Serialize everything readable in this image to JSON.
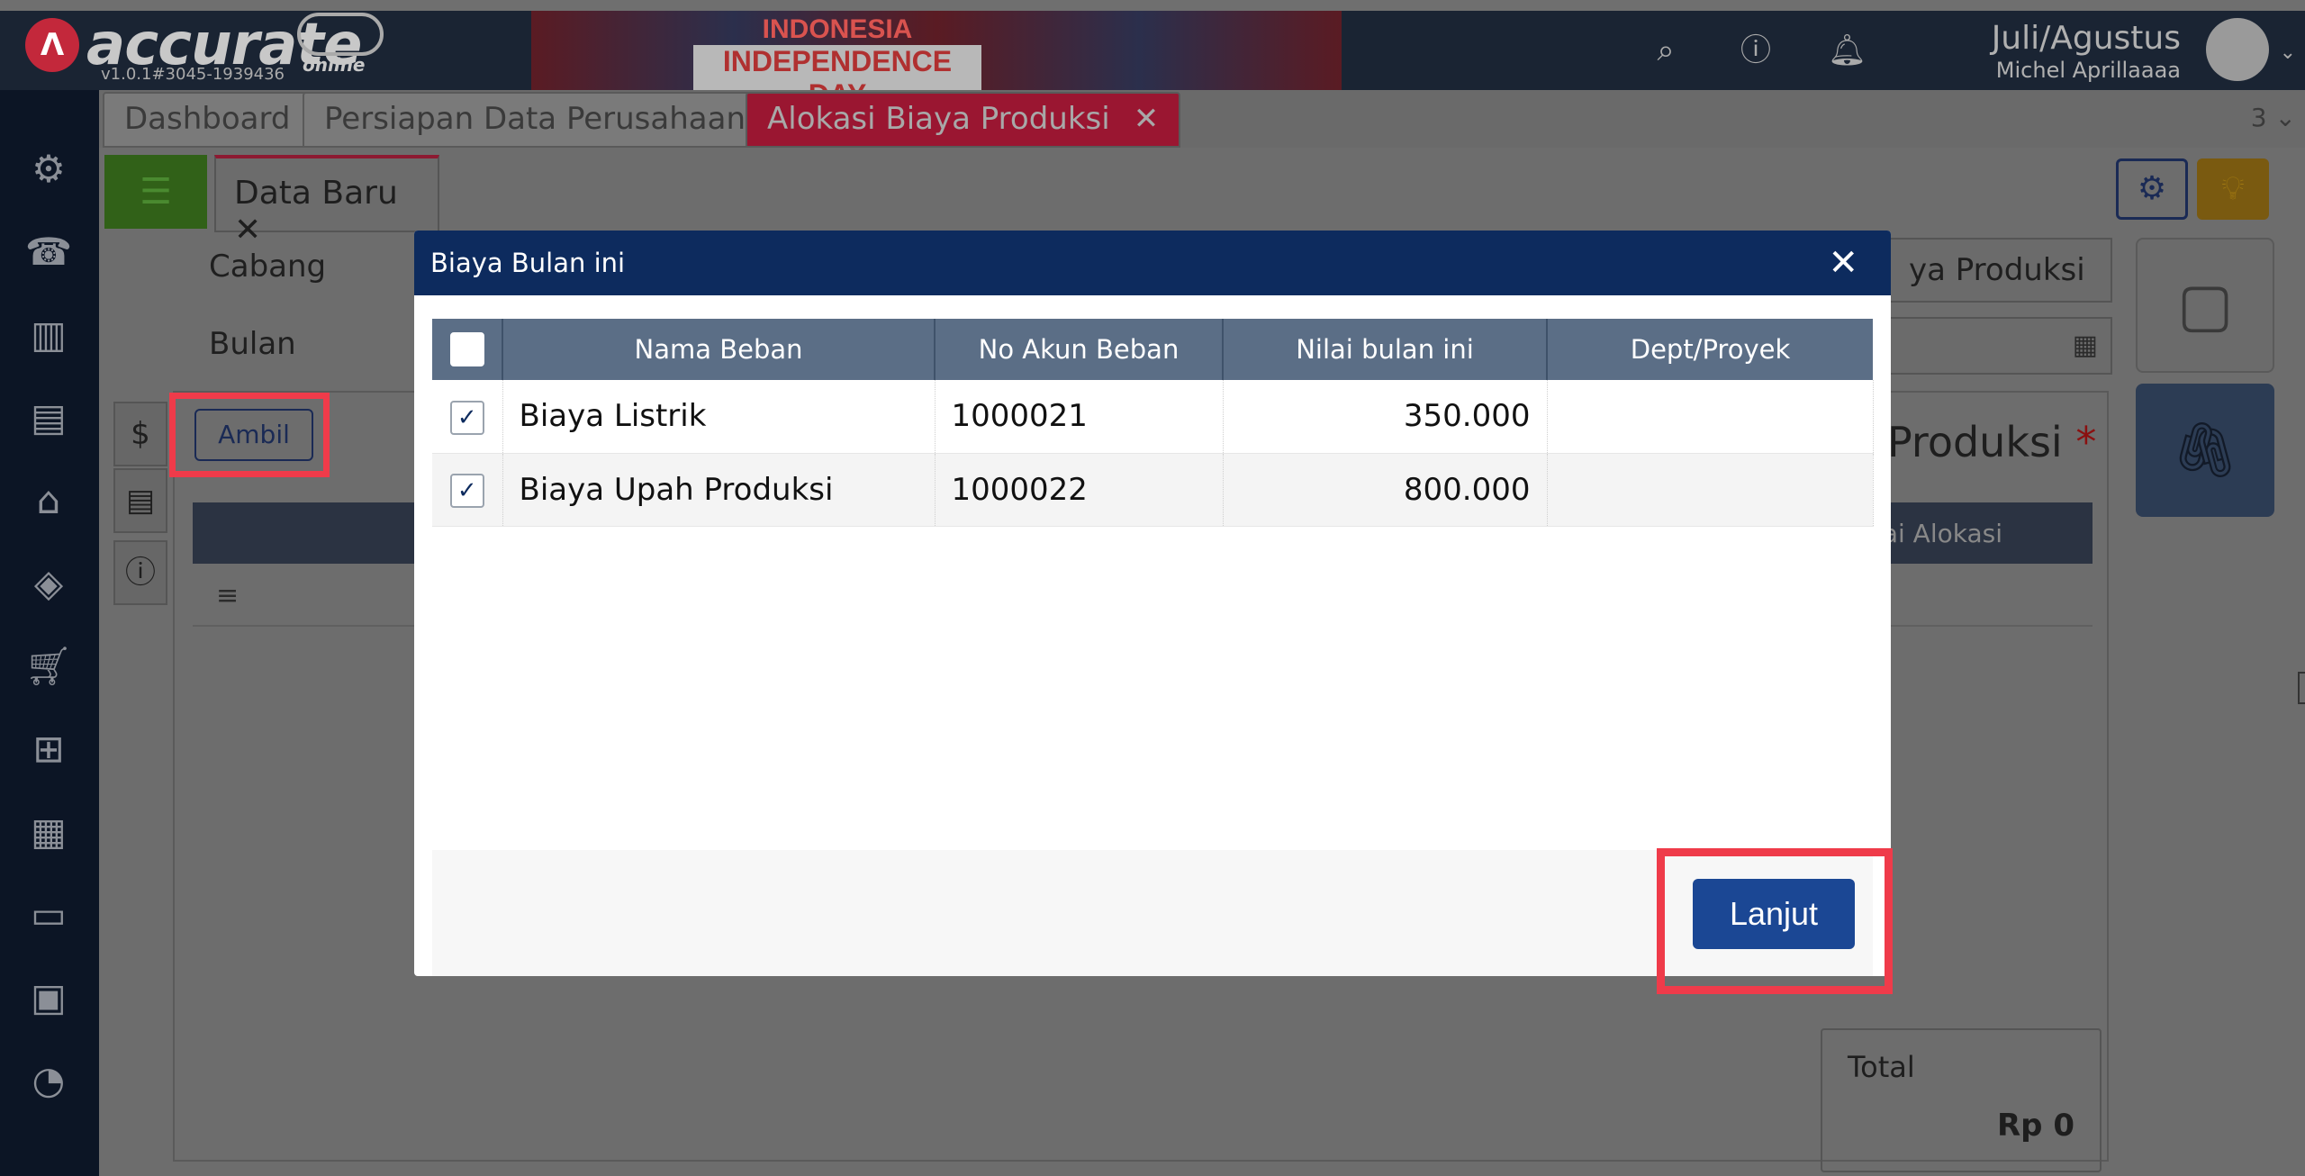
{
  "header": {
    "brand": "accurate",
    "brand_sub": "online",
    "version": "v1.0.1#3045-1939436",
    "banner_line1": "INDONESIA",
    "banner_line2": "INDEPENDENCE DAY",
    "period": "Juli/Agustus",
    "user": "Michel Aprillaaaa",
    "icons": [
      "search-icon",
      "help-icon",
      "bell-icon",
      "avatar-icon"
    ]
  },
  "sidebar": {
    "icons": [
      "gear-icon",
      "fax-icon",
      "building-icon",
      "book-icon",
      "bank-icon",
      "price-tag-icon",
      "cart-icon",
      "trolley-icon",
      "factory-icon",
      "conveyor-icon",
      "tax-icon",
      "report-icon"
    ]
  },
  "tabs": {
    "items": [
      "Dashboard",
      "Persiapan Data Perusahaan",
      "Alokasi Biaya Produksi"
    ],
    "more": "3"
  },
  "page": {
    "subtab": "Data Baru",
    "cabang_label": "Cabang",
    "bulan_label": "Bulan",
    "ambil_label": "Ambil",
    "select_value": "ya Produksi",
    "section_title": "Produksi",
    "required_mark": "*",
    "col_alokasi": "Nilai Alokasi",
    "total_label": "Total",
    "total_value": "Rp 0"
  },
  "modal": {
    "title": "Biaya Bulan ini",
    "close": "✕",
    "columns": [
      "Nama Beban",
      "No Akun Beban",
      "Nilai bulan ini",
      "Dept/Proyek"
    ],
    "rows": [
      {
        "checked": true,
        "nama": "Biaya Listrik",
        "akun": "1000021",
        "nilai": "350.000",
        "dept": ""
      },
      {
        "checked": true,
        "nama": "Biaya Upah Produksi",
        "akun": "1000022",
        "nilai": "800.000",
        "dept": ""
      }
    ],
    "action": "Lanjut"
  },
  "colors": {
    "modal_header": "#0d2b5e",
    "table_header": "#5b6e86",
    "primary_button": "#1b4794",
    "highlight": "#ef3b4a"
  }
}
